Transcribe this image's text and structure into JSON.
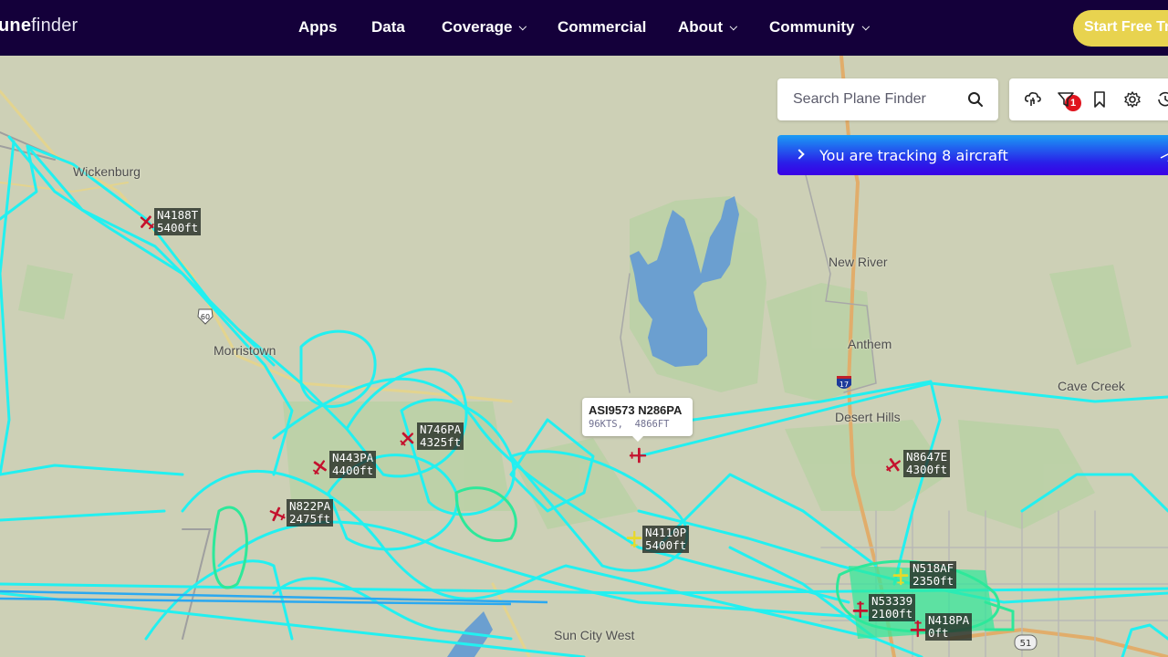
{
  "nav": {
    "logo_bold": "une",
    "logo_light": "finder",
    "items": [
      {
        "label": "Apps",
        "has_dropdown": false
      },
      {
        "label": "Data",
        "has_dropdown": false
      },
      {
        "label": "Coverage",
        "has_dropdown": true
      },
      {
        "label": "Commercial",
        "has_dropdown": false
      },
      {
        "label": "About",
        "has_dropdown": true
      },
      {
        "label": "Community",
        "has_dropdown": true
      }
    ],
    "cta_label": "Start Free Trial"
  },
  "search": {
    "placeholder": "Search Plane Finder",
    "value": "",
    "icon": "search-icon"
  },
  "toolbar": {
    "icons": [
      "cloud-rain-icon",
      "filter-icon",
      "bookmark-icon",
      "gear-icon",
      "history-icon"
    ],
    "filter_badge": "1"
  },
  "tracking_bar": {
    "text": "You are tracking 8 aircraft",
    "icon": "chevron-right-icon"
  },
  "colors": {
    "nav_bg": "#14003a",
    "cta": "#e8d34f",
    "track_cyan": "#22f0f0",
    "track_green": "#2de89a",
    "aircraft_red": "#c4122e",
    "aircraft_yellow": "#e8d92a",
    "water": "#6b9fd0"
  },
  "map": {
    "places": [
      {
        "name": "Wickenburg"
      },
      {
        "name": "Morristown"
      },
      {
        "name": "New River"
      },
      {
        "name": "Anthem"
      },
      {
        "name": "Desert Hills"
      },
      {
        "name": "Cave Creek"
      },
      {
        "name": "Sun City West"
      }
    ],
    "shields": [
      {
        "label": "60",
        "type": "us-highway"
      },
      {
        "label": "17",
        "type": "interstate"
      },
      {
        "label": "51",
        "type": "state-route"
      }
    ],
    "popup": {
      "title": "ASI9573 N286PA",
      "detail": "96KTS,  4866FT"
    },
    "aircraft": [
      {
        "callsign": "N4188T",
        "altitude": "5400ft",
        "color": "red"
      },
      {
        "callsign": "N746PA",
        "altitude": "4325ft",
        "color": "red"
      },
      {
        "callsign": "N443PA",
        "altitude": "4400ft",
        "color": "red"
      },
      {
        "callsign": "N822PA",
        "altitude": "2475ft",
        "color": "red"
      },
      {
        "callsign": "N4110P",
        "altitude": "5400ft",
        "color": "yellow"
      },
      {
        "callsign": "N8647E",
        "altitude": "4300ft",
        "color": "red"
      },
      {
        "callsign": "N518AF",
        "altitude": "2350ft",
        "color": "yellow"
      },
      {
        "callsign": "N53339",
        "altitude": "2100ft",
        "color": "red"
      },
      {
        "callsign": "N418PA",
        "altitude": "0ft",
        "color": "red"
      },
      {
        "callsign": "N286PA",
        "altitude": "",
        "color": "red"
      }
    ]
  }
}
